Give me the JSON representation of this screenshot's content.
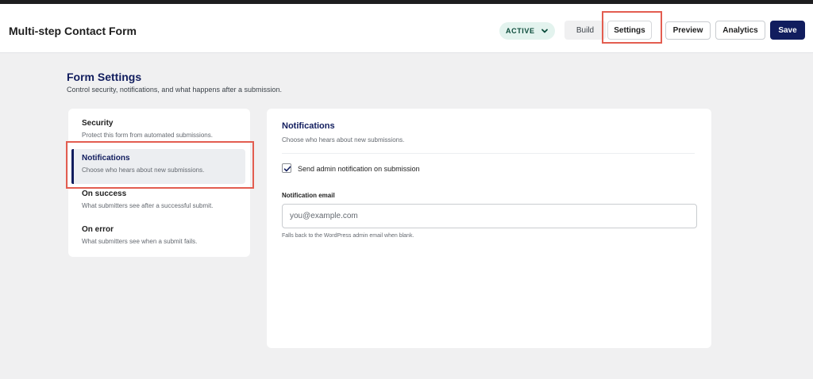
{
  "header": {
    "title": "Multi-step Contact Form",
    "status": {
      "label": "ACTIVE",
      "icon": "chevron-down-icon"
    },
    "buttons": {
      "build": "Build",
      "settings": "Settings",
      "preview": "Preview",
      "analytics": "Analytics",
      "save": "Save"
    }
  },
  "page": {
    "heading": "Form Settings",
    "subtitle": "Control security, notifications, and what happens after a submission."
  },
  "sidebar": {
    "items": [
      {
        "label": "Security",
        "description": "Protect this form from automated submissions.",
        "active": false
      },
      {
        "label": "Notifications",
        "description": "Choose who hears about new submissions.",
        "active": true
      },
      {
        "label": "On success",
        "description": "What submitters see after a successful submit.",
        "active": false
      },
      {
        "label": "On error",
        "description": "What submitters see when a submit fails.",
        "active": false
      }
    ]
  },
  "main": {
    "title": "Notifications",
    "subtitle": "Choose who hears about new submissions.",
    "admin_notification": {
      "label": "Send admin notification on submission",
      "checked": true
    },
    "email": {
      "label": "Notification email",
      "value": "",
      "placeholder": "you@example.com",
      "help": "Falls back to the WordPress admin email when blank."
    }
  },
  "colors": {
    "brand": "#111d5e",
    "active_pill_bg": "#e3f3ee",
    "active_pill_text": "#0b4b3a",
    "highlight": "#e35d50"
  }
}
